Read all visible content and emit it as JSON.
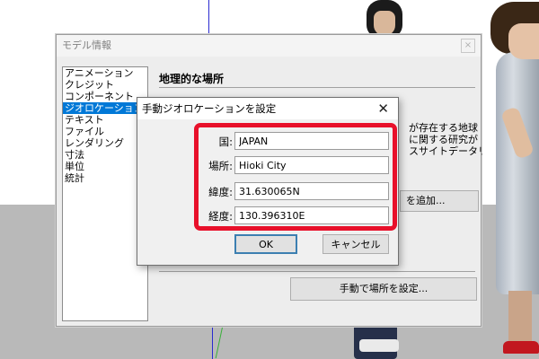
{
  "model_info": {
    "title": "モデル情報",
    "close_glyph": "×",
    "nav_items": [
      "アニメーション",
      "クレジット",
      "コンポーネント",
      "ジオロケーション",
      "テキスト",
      "ファイル",
      "レンダリング",
      "寸法",
      "単位",
      "統計"
    ],
    "selected_nav_index": 3,
    "section_title": "地理的な場所",
    "description_lines": [
      "が存在する地球",
      "に関する研究が",
      "スサイトデータリ"
    ],
    "add_location_label": "を追加...",
    "manual_location_button": "手動で場所を設定..."
  },
  "geo_dialog": {
    "title": "手動ジオロケーションを設定",
    "close_glyph": "✕",
    "fields": {
      "country": {
        "label": "国:",
        "value": "JAPAN"
      },
      "location": {
        "label": "場所:",
        "value": "Hioki City"
      },
      "latitude": {
        "label": "緯度:",
        "value": "31.630065N"
      },
      "longitude": {
        "label": "経度:",
        "value": "130.396310E"
      }
    },
    "ok_label": "OK",
    "cancel_label": "キャンセル"
  },
  "colors": {
    "highlight": "#e8102a",
    "selection": "#0078d7",
    "ground": "#b9b9b9"
  }
}
